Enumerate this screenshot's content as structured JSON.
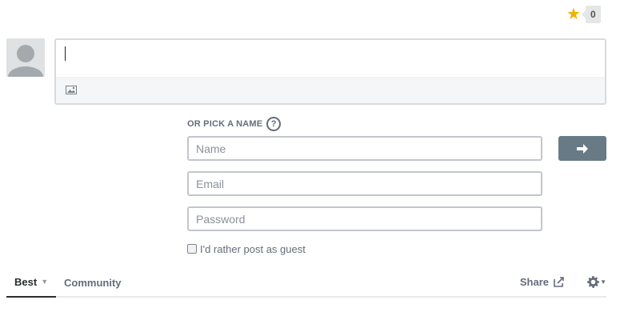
{
  "recommend": {
    "star_icon": "star-icon",
    "count": "0"
  },
  "avatar": {
    "icon": "default-avatar-icon"
  },
  "editor": {
    "placeholder": "",
    "toolbar": {
      "image_icon": "image-icon"
    }
  },
  "guest_login": {
    "pick_name_label": "OR PICK A NAME",
    "help_icon_text": "?",
    "name_placeholder": "Name",
    "email_placeholder": "Email",
    "password_placeholder": "Password",
    "submit_icon": "arrow-right-icon",
    "guest_checkbox_label": "I'd rather post as guest",
    "guest_checked": false
  },
  "nav": {
    "tabs": [
      {
        "label": "Best",
        "active": true
      },
      {
        "label": "Community",
        "active": false
      }
    ],
    "share_label": "Share",
    "share_icon": "share-icon",
    "settings_icon": "gear-icon"
  },
  "colors": {
    "star": "#f0b000",
    "submit_bg": "#687a86",
    "text_muted": "#656c7a"
  }
}
